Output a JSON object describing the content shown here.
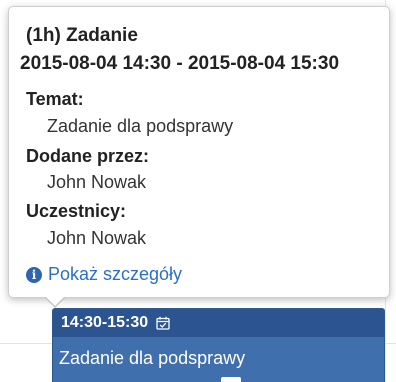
{
  "tooltip": {
    "title": "(1h) Zadanie",
    "dates": "2015-08-04 14:30 - 2015-08-04 15:30",
    "subject_label": "Temat:",
    "subject_value": "Zadanie dla podsprawy",
    "added_by_label": "Dodane przez:",
    "added_by_value": "John Nowak",
    "participants_label": "Uczestnicy:",
    "participants_value": "John Nowak",
    "details_link": "Pokaż szczegóły",
    "details_icon": "info-circle-icon"
  },
  "event": {
    "time": "14:30-15:30",
    "type_icon": "calendar-check-icon",
    "title": "Zadanie dla podsprawy"
  },
  "colors": {
    "event_background": "#3f6fac",
    "event_header": "#2b5491",
    "link": "#2a6fc9"
  }
}
